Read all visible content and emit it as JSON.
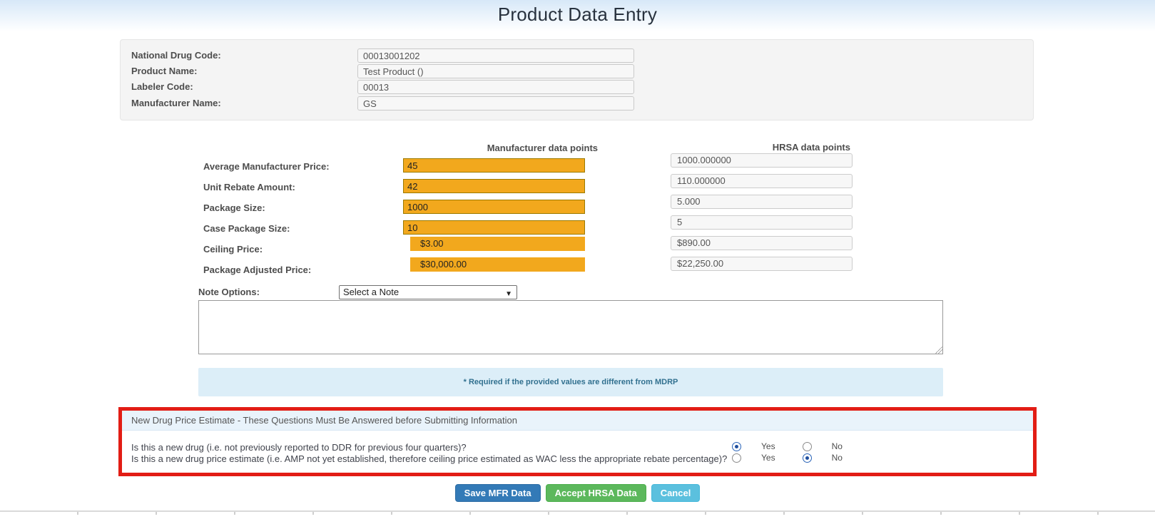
{
  "page": {
    "title": "Product Data Entry"
  },
  "product_info": {
    "fields": [
      {
        "label": "National Drug Code:",
        "value": "00013001202"
      },
      {
        "label": "Product Name:",
        "value": "Test Product ()"
      },
      {
        "label": "Labeler Code:",
        "value": "00013"
      },
      {
        "label": "Manufacturer Name:",
        "value": "GS"
      }
    ]
  },
  "data_points": {
    "mfr_header": "Manufacturer data points",
    "hrsa_header": "HRSA data points",
    "rows": [
      {
        "label": "Average Manufacturer Price:",
        "mfr": "45",
        "hrsa": "1000.000000"
      },
      {
        "label": "Unit Rebate Amount:",
        "mfr": "42",
        "hrsa": "110.000000"
      },
      {
        "label": "Package Size:",
        "mfr": "1000",
        "hrsa": "5.000"
      },
      {
        "label": "Case Package Size:",
        "mfr": "10",
        "hrsa": "5"
      },
      {
        "label": "Ceiling Price:",
        "mfr": "$3.00",
        "hrsa": "$890.00"
      },
      {
        "label": "Package Adjusted Price:",
        "mfr": "$30,000.00",
        "hrsa": "$22,250.00"
      }
    ]
  },
  "notes": {
    "label": "Note Options:",
    "selected_option": "Select a Note",
    "comment_value": ""
  },
  "required_note": "* Required if the provided values are different from MDRP",
  "new_drug_section": {
    "header": "New Drug Price Estimate - These Questions Must Be Answered before Submitting Information",
    "questions": [
      {
        "text": "Is this a new drug (i.e. not previously reported to DDR for previous four quarters)?",
        "yes_label": "Yes",
        "no_label": "No",
        "answer": "Yes"
      },
      {
        "text": "Is this a new drug price estimate (i.e. AMP not yet established, therefore ceiling price estimated as WAC less the appropriate rebate percentage)?",
        "yes_label": "Yes",
        "no_label": "No",
        "answer": "No"
      }
    ]
  },
  "buttons": {
    "save": "Save MFR Data",
    "accept": "Accept HRSA Data",
    "cancel": "Cancel"
  },
  "colors": {
    "mfr_input_bg": "#f2a81d",
    "banner_bg": "#dceef8",
    "banner_text": "#31708f",
    "alert_border": "#e21d15",
    "save_button": "#337ab7",
    "accept_button": "#5cb85c",
    "cancel_button": "#5bc0de"
  }
}
